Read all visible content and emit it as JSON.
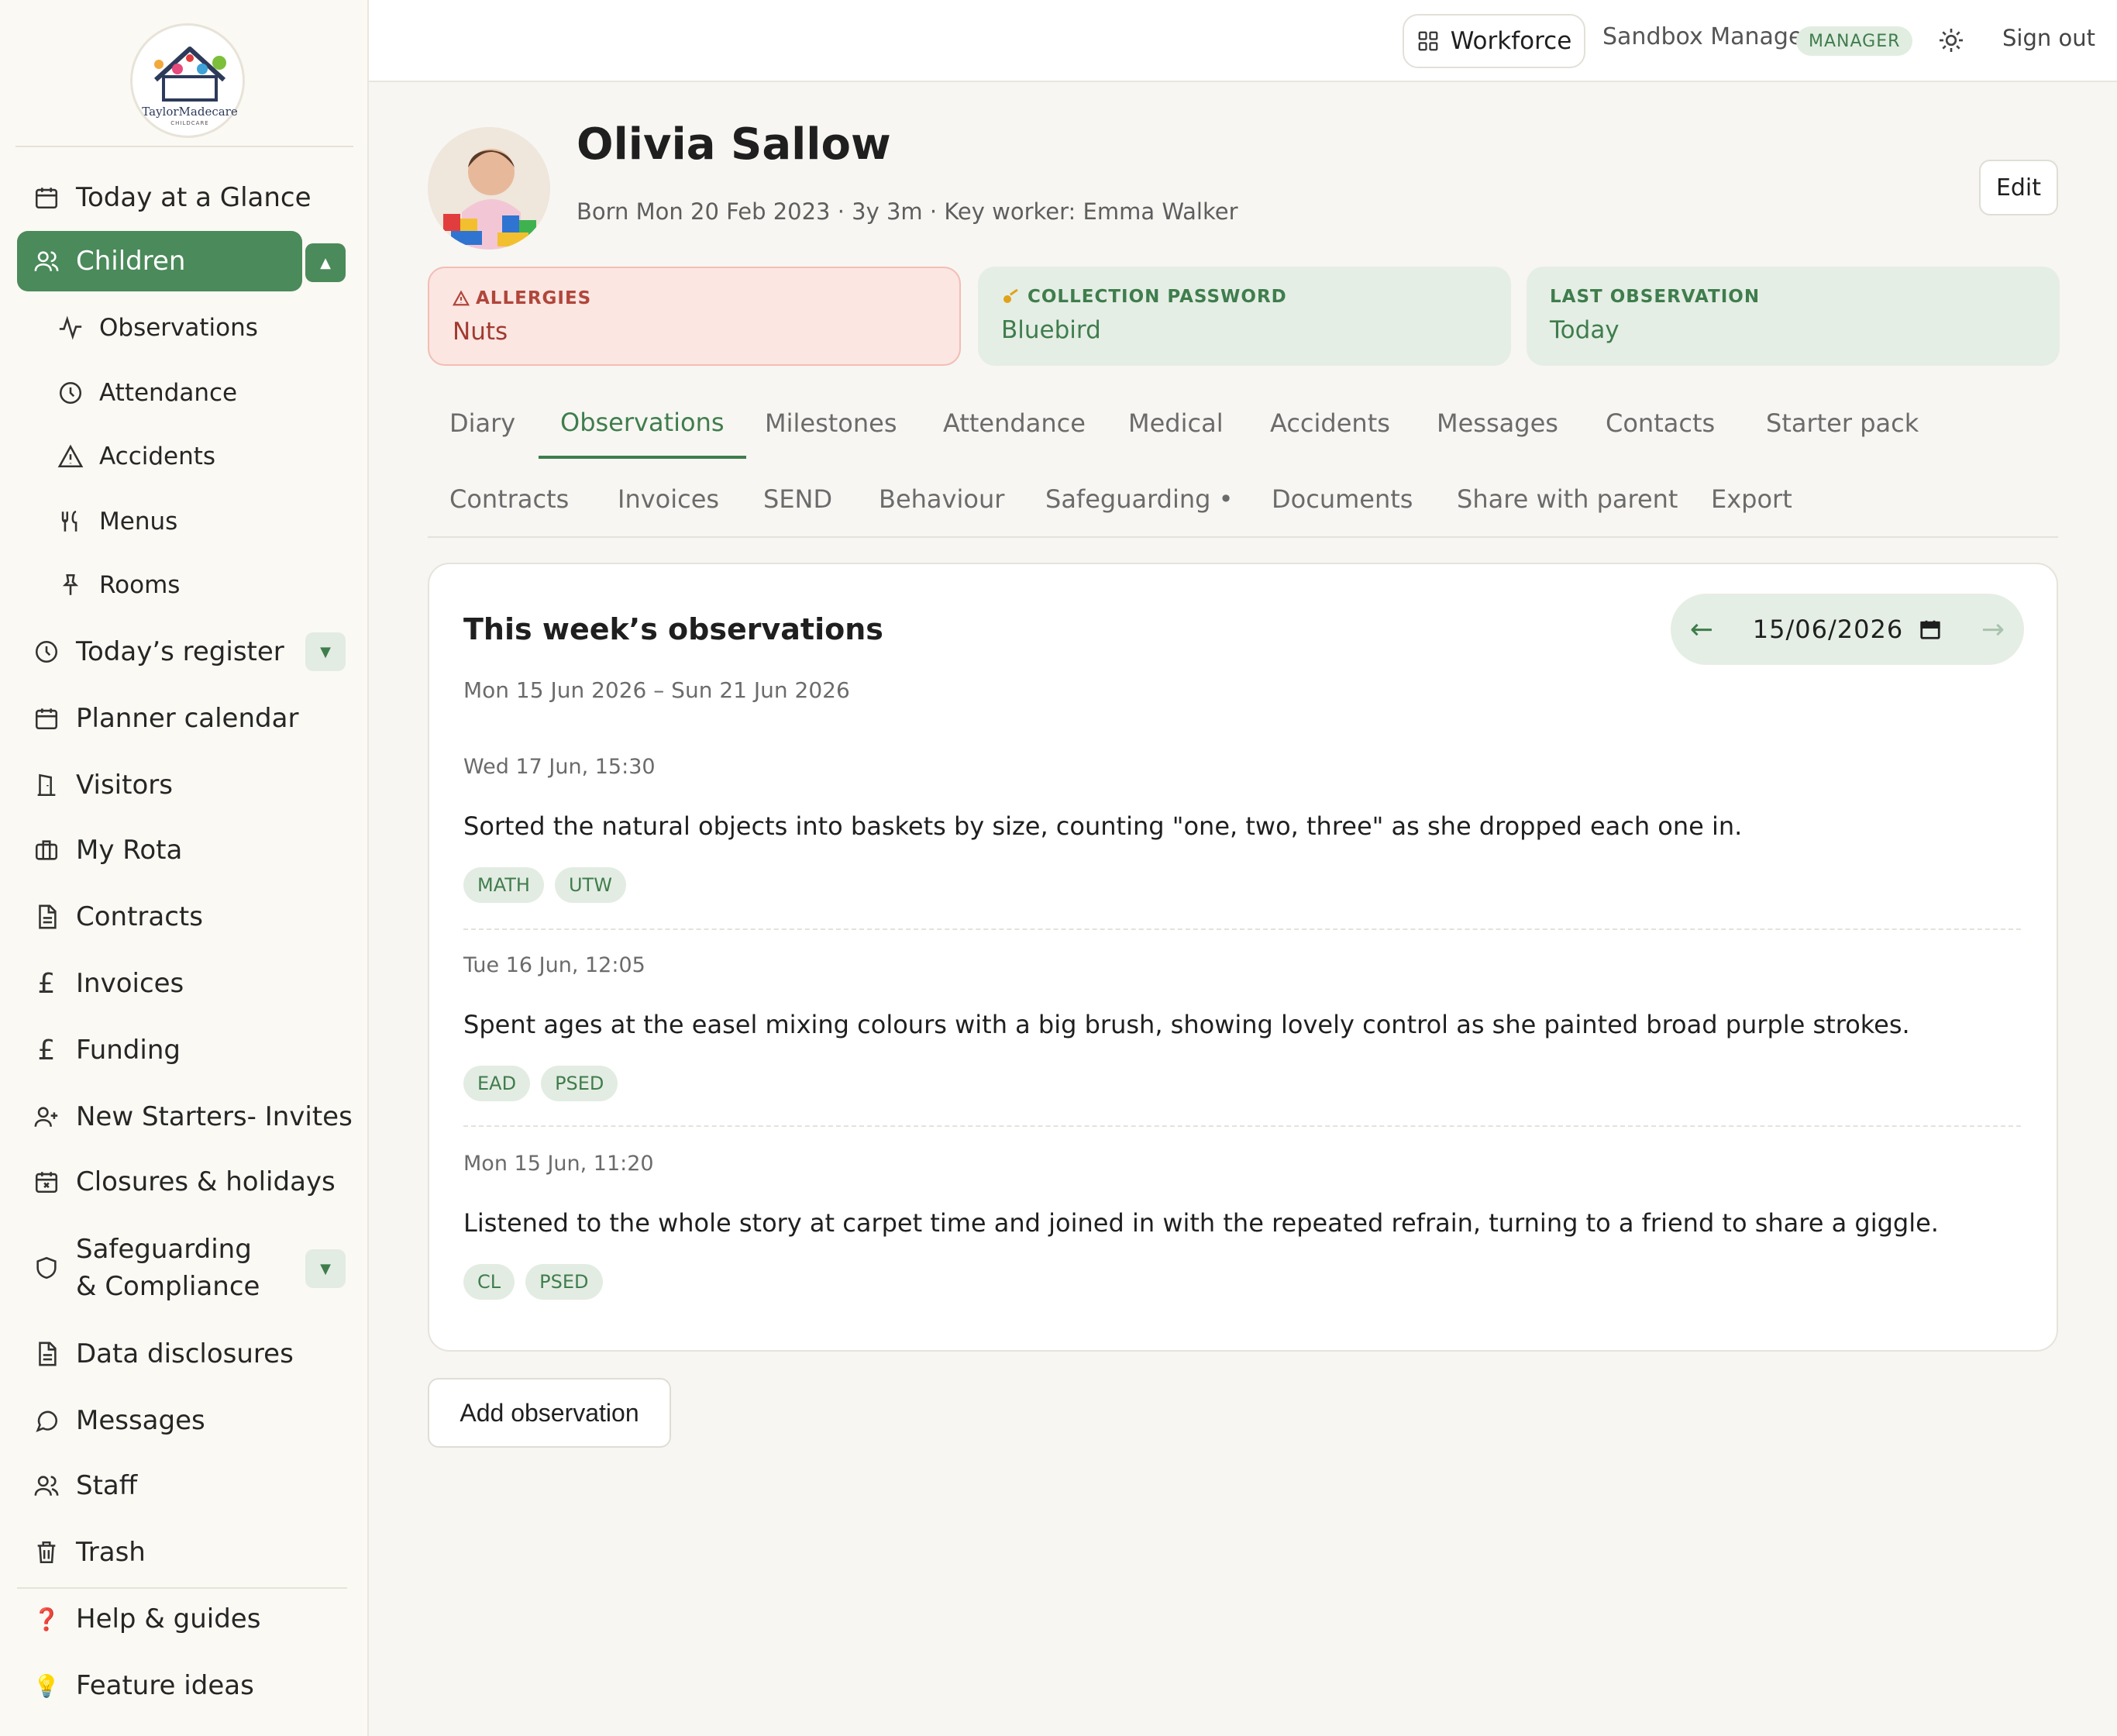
{
  "brand": {
    "logo_text": "TaylorMadecare",
    "logo_sub": "CHILDCARE"
  },
  "sidebar": {
    "items": [
      {
        "key": "today",
        "label": "Today at a Glance",
        "icon": "calendar-icon"
      },
      {
        "key": "children",
        "label": "Children",
        "icon": "users-icon",
        "active": true,
        "caret": "▲"
      },
      {
        "key": "observations",
        "label": "Observations",
        "icon": "activity-icon",
        "sub": true
      },
      {
        "key": "attendance",
        "label": "Attendance",
        "icon": "clock-icon",
        "sub": true
      },
      {
        "key": "accidents",
        "label": "Accidents",
        "icon": "warning-icon",
        "sub": true
      },
      {
        "key": "menus",
        "label": "Menus",
        "icon": "utensils-icon",
        "sub": true
      },
      {
        "key": "rooms",
        "label": "Rooms",
        "icon": "pin-icon",
        "sub": true
      },
      {
        "key": "register",
        "label": "Today’s register",
        "icon": "clock-icon",
        "caret": "▼"
      },
      {
        "key": "planner",
        "label": "Planner calendar",
        "icon": "calendar-icon"
      },
      {
        "key": "visitors",
        "label": "Visitors",
        "icon": "door-icon"
      },
      {
        "key": "rota",
        "label": "My Rota",
        "icon": "briefcase-icon"
      },
      {
        "key": "contracts",
        "label": "Contracts",
        "icon": "document-icon"
      },
      {
        "key": "invoices",
        "label": "Invoices",
        "icon": "pound-icon"
      },
      {
        "key": "funding",
        "label": "Funding",
        "icon": "pound-icon"
      },
      {
        "key": "starters",
        "label": "New Starters- Invites",
        "icon": "user-plus-icon"
      },
      {
        "key": "closures",
        "label": "Closures & holidays",
        "icon": "calendar-x-icon"
      },
      {
        "key": "safeguarding",
        "label": "Safeguarding & Compliance",
        "icon": "shield-icon",
        "caret": "▼"
      },
      {
        "key": "disclosures",
        "label": "Data disclosures",
        "icon": "document-icon"
      },
      {
        "key": "messages",
        "label": "Messages",
        "icon": "chat-icon"
      },
      {
        "key": "staff",
        "label": "Staff",
        "icon": "users-icon"
      },
      {
        "key": "trash",
        "label": "Trash",
        "icon": "trash-icon"
      }
    ],
    "bottom": [
      {
        "key": "help",
        "label": "Help & guides",
        "emoji": "❓"
      },
      {
        "key": "ideas",
        "label": "Feature ideas",
        "emoji": "💡"
      }
    ]
  },
  "topbar": {
    "workforce_label": "Workforce",
    "user_name": "Sandbox Manager",
    "role_badge": "MANAGER",
    "signout_label": "Sign out"
  },
  "child": {
    "name": "Olivia Sallow",
    "meta": "Born Mon 20 Feb 2023 · 3y 3m · Key worker: Emma Walker",
    "edit_label": "Edit"
  },
  "cards": {
    "allergies": {
      "label": "ALLERGIES",
      "value": "Nuts",
      "icon": "warning-icon"
    },
    "password": {
      "label": "COLLECTION PASSWORD",
      "value": "Bluebird",
      "icon": "key-icon"
    },
    "last_obs": {
      "label": "LAST OBSERVATION",
      "value": "Today"
    }
  },
  "tabs": {
    "row1": [
      "Diary",
      "Observations",
      "Milestones",
      "Attendance",
      "Medical",
      "Accidents",
      "Messages",
      "Contacts",
      "Starter pack"
    ],
    "row2": [
      "Contracts",
      "Invoices",
      "SEND",
      "Behaviour",
      "Safeguarding •",
      "Documents",
      "Share with parent",
      "Export"
    ],
    "active": "Observations"
  },
  "observations": {
    "title": "This week’s observations",
    "range": "Mon 15 Jun 2026 – Sun 21 Jun 2026",
    "date_value": "15/06/2026",
    "prev_arrow": "←",
    "next_arrow": "→",
    "entries": [
      {
        "time": "Wed 17 Jun, 15:30",
        "text": "Sorted the natural objects into baskets by size, counting \"one, two, three\" as she dropped each one in.",
        "tags": [
          "MATH",
          "UTW"
        ]
      },
      {
        "time": "Tue 16 Jun, 12:05",
        "text": "Spent ages at the easel mixing colours with a big brush, showing lovely control as she painted broad purple strokes.",
        "tags": [
          "EAD",
          "PSED"
        ]
      },
      {
        "time": "Mon 15 Jun, 11:20",
        "text": "Listened to the whole story at carpet time and joined in with the repeated refrain, turning to a friend to share a giggle.",
        "tags": [
          "CL",
          "PSED"
        ]
      }
    ],
    "add_label": "Add observation"
  },
  "colors": {
    "accent": "#4b8a5a",
    "accent_light": "#e5eee5",
    "danger_bg": "#fbe6e2",
    "danger_text": "#a13a2f"
  }
}
